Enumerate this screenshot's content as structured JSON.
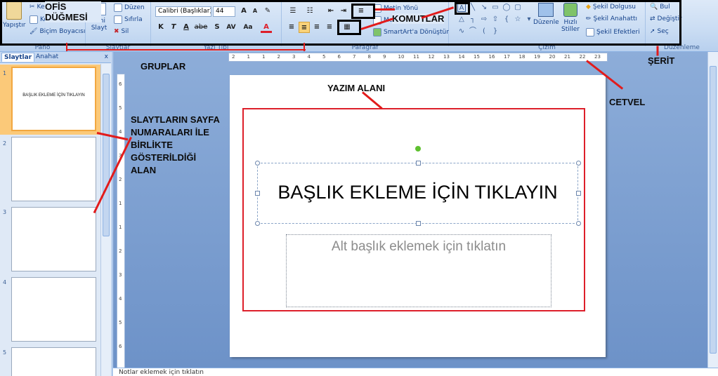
{
  "ribbon": {
    "clipboard": {
      "paste": "Yapıştır",
      "cut": "Kes",
      "copy": "Kopyala",
      "format_painter": "Biçim Boyacısı",
      "label": "Pano"
    },
    "slides": {
      "new_slide": "Yeni Slayt",
      "layout": "Düzen",
      "reset": "Sıfırla",
      "delete": "Sil",
      "label": "Slaytlar"
    },
    "font": {
      "family": "Calibri (Başlıklar)",
      "size": "44",
      "label": "Yazı Tipi",
      "bold": "K",
      "italic": "T",
      "underline": "A",
      "strike": "abe",
      "shadow": "S",
      "spacing": "AV",
      "case": "Aa",
      "color": "A"
    },
    "paragraph": {
      "text_direction": "Metin Yönü",
      "align_text": "Metni Hizala",
      "smartart": "SmartArt'a Dönüştür",
      "label": "Paragraf"
    },
    "drawing": {
      "arrange": "Düzenle",
      "quick_styles": "Hızlı Stiller",
      "shape_fill": "Şekil Dolgusu",
      "shape_outline": "Şekil Anahattı",
      "shape_effects": "Şekil Efektleri",
      "label": "Çizim"
    },
    "editing": {
      "find": "Bul",
      "replace": "Değiştir",
      "select": "Seç",
      "label": "Düzenleme"
    }
  },
  "annotations": {
    "office_button": "OFİS DÜĞMESİ",
    "commands": "KOMUTLAR",
    "groups": "GRUPLAR",
    "ribbon": "ŞERİT",
    "ruler": "CETVEL",
    "writing_area": "YAZIM ALANI",
    "slide_numbers": "SLAYTLARIN SAYFA NUMARALARI İLE BİRLİKTE GÖSTERİLDİĞİ ALAN"
  },
  "pane": {
    "tabs": [
      "Slaytlar",
      "Anahat"
    ],
    "close": "x",
    "thumbs": [
      {
        "num": "1",
        "title": "BAŞLIK EKLEME İÇİN TIKLAYIN"
      },
      {
        "num": "2",
        "title": ""
      },
      {
        "num": "3",
        "title": ""
      },
      {
        "num": "4",
        "title": ""
      },
      {
        "num": "5",
        "title": ""
      }
    ]
  },
  "ruler": {
    "h_ticks": [
      "2",
      "1",
      "1",
      "2",
      "3",
      "4",
      "5",
      "6",
      "7",
      "8",
      "9",
      "10",
      "11",
      "12",
      "13",
      "14",
      "15",
      "16",
      "17",
      "18",
      "19",
      "20",
      "21",
      "22",
      "23"
    ],
    "v_ticks": [
      "6",
      "5",
      "4",
      "3",
      "2",
      "1",
      "1",
      "2",
      "3",
      "4",
      "5",
      "6"
    ]
  },
  "slide": {
    "title": "BAŞLIK EKLEME İÇİN TIKLAYIN",
    "subtitle": "Alt başlık eklemek için tıklatın"
  },
  "notes": {
    "placeholder": "Notlar eklemek için tıklatın"
  },
  "colors": {
    "annotation_red": "#dd1f2a",
    "ribbon_bg": "#c9dcf3",
    "editor_bg": "#7a9ccf"
  }
}
